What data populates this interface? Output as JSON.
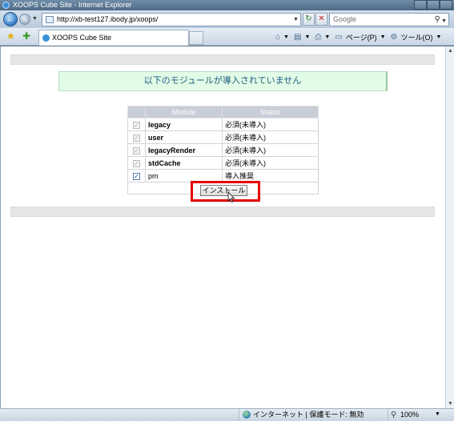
{
  "window": {
    "title": "XOOPS Cube Site - Internet Explorer"
  },
  "address_bar": {
    "url": "http://xb-test127.ibody.jp/xoops/",
    "search_placeholder": "Google"
  },
  "tab": {
    "label": "XOOPS Cube Site"
  },
  "toolbar": {
    "page_menu": "ページ(P)",
    "tools_menu": "ツール(O)"
  },
  "page": {
    "notice": "以下のモジュールが導入されていません",
    "table": {
      "headers": [
        "Module",
        "Status"
      ],
      "rows": [
        {
          "module": "legacy",
          "status": "必須(未導入)",
          "checked": true,
          "disabled": true
        },
        {
          "module": "user",
          "status": "必須(未導入)",
          "checked": true,
          "disabled": true
        },
        {
          "module": "legacyRender",
          "status": "必須(未導入)",
          "checked": true,
          "disabled": true
        },
        {
          "module": "stdCache",
          "status": "必須(未導入)",
          "checked": true,
          "disabled": true
        },
        {
          "module": "pm",
          "status": "導入推奨",
          "checked": true,
          "disabled": false
        }
      ]
    },
    "install_button": "インストール"
  },
  "status_bar": {
    "zone": "インターネット | 保護モード: 無効",
    "zoom": "100%"
  },
  "colors": {
    "highlight": "#e30000",
    "notice_bg": "#e2fbe6",
    "header_bg": "#c7ced6"
  }
}
